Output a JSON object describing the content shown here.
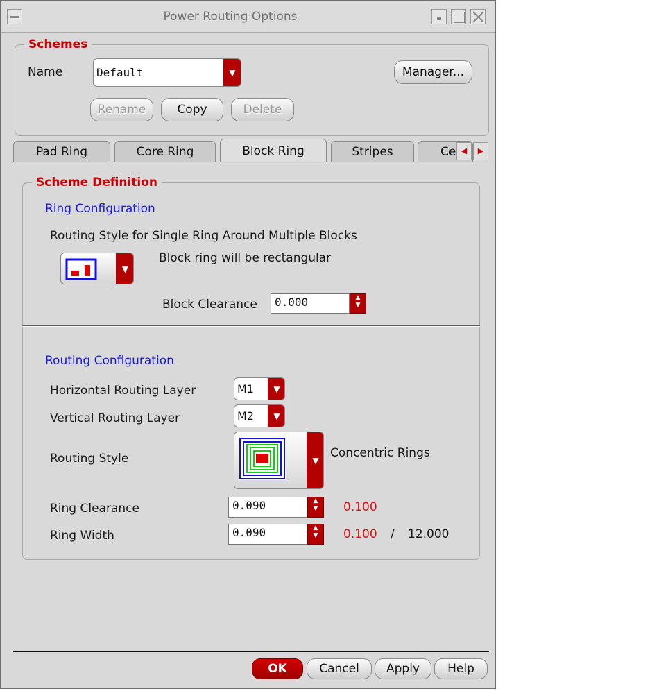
{
  "window": {
    "title": "Power Routing Options"
  },
  "schemes": {
    "legend": "Schemes",
    "name_label": "Name",
    "name_value": "Default",
    "manager_label": "Manager...",
    "rename_label": "Rename",
    "copy_label": "Copy",
    "delete_label": "Delete"
  },
  "tabs": [
    {
      "label": "Pad Ring"
    },
    {
      "label": "Core Ring"
    },
    {
      "label": "Block Ring",
      "active": true
    },
    {
      "label": "Stripes"
    },
    {
      "label": "Ce"
    }
  ],
  "scheme_definition": {
    "legend": "Scheme Definition",
    "ring_config": {
      "heading": "Ring Configuration",
      "routing_style_label": "Routing Style for Single Ring Around Multiple Blocks",
      "style_desc": "Block ring will be rectangular",
      "block_clearance_label": "Block Clearance",
      "block_clearance_value": "0.000"
    },
    "routing_config": {
      "heading": "Routing Configuration",
      "h_layer_label": "Horizontal Routing Layer",
      "h_layer_value": "M1",
      "v_layer_label": "Vertical Routing Layer",
      "v_layer_value": "M2",
      "routing_style_label": "Routing Style",
      "routing_style_value": "Concentric Rings",
      "ring_clearance_label": "Ring Clearance",
      "ring_clearance_value": "0.090",
      "ring_clearance_min": "0.100",
      "ring_width_label": "Ring Width",
      "ring_width_value": "0.090",
      "ring_width_min": "0.100",
      "ring_width_sep": "/",
      "ring_width_max": "12.000"
    }
  },
  "footer": {
    "ok_label": "OK",
    "cancel_label": "Cancel",
    "apply_label": "Apply",
    "help_label": "Help"
  },
  "colors": {
    "accent_red": "#b30000",
    "heading_blue": "#1a1ae0",
    "legend_red": "#cc0000"
  }
}
